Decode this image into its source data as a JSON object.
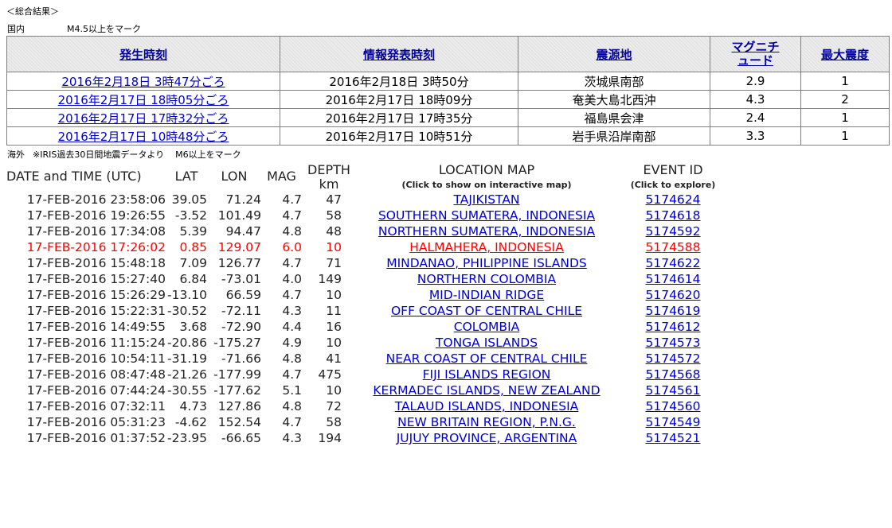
{
  "section_title": "＜総合結果＞",
  "domestic": {
    "label": "国内",
    "note": "M4.5以上をマーク",
    "headers": [
      "発生時刻",
      "情報発表時刻",
      "震源地",
      "マグニチュード",
      "最大震度"
    ],
    "rows": [
      [
        "2016年2月18日 3時47分ごろ",
        "2016年2月18日 3時50分",
        "茨城県南部",
        "2.9",
        "1"
      ],
      [
        "2016年2月17日 18時05分ごろ",
        "2016年2月17日 18時09分",
        "奄美大島北西沖",
        "4.3",
        "2"
      ],
      [
        "2016年2月17日 17時32分ごろ",
        "2016年2月17日 17時35分",
        "福島県会津",
        "2.4",
        "1"
      ],
      [
        "2016年2月17日 10時48分ごろ",
        "2016年2月17日 10時51分",
        "岩手県沿岸南部",
        "3.3",
        "1"
      ]
    ]
  },
  "overseas": {
    "label": "海外",
    "note1": "※IRIS過去30日間地震データより",
    "note2": "M6以上をマーク",
    "headers": {
      "datetime": "DATE and TIME (UTC)",
      "lat": "LAT",
      "lon": "LON",
      "mag": "MAG",
      "depth": "DEPTH",
      "depth_unit": "km",
      "location": "LOCATION MAP",
      "location_sub": "(Click to show on interactive map)",
      "event": "EVENT ID",
      "event_sub": "(Click to explore)"
    },
    "rows": [
      {
        "datetime": "17-FEB-2016 23:58:06",
        "lat": "39.05",
        "lon": "71.24",
        "mag": "4.7",
        "depth": "47",
        "location": "TAJIKISTAN",
        "event": "5174624"
      },
      {
        "datetime": "17-FEB-2016 19:26:55",
        "lat": "-3.52",
        "lon": "101.49",
        "mag": "4.7",
        "depth": "58",
        "location": "SOUTHERN SUMATERA, INDONESIA",
        "event": "5174618"
      },
      {
        "datetime": "17-FEB-2016 17:34:08",
        "lat": "5.39",
        "lon": "94.47",
        "mag": "4.8",
        "depth": "48",
        "location": "NORTHERN SUMATERA, INDONESIA",
        "event": "5174592"
      },
      {
        "datetime": "17-FEB-2016 17:26:02",
        "lat": "0.85",
        "lon": "129.07",
        "mag": "6.0",
        "depth": "10",
        "location": "HALMAHERA, INDONESIA",
        "event": "5174588",
        "highlight": true
      },
      {
        "datetime": "17-FEB-2016 15:48:18",
        "lat": "7.09",
        "lon": "126.77",
        "mag": "4.7",
        "depth": "71",
        "location": "MINDANAO, PHILIPPINE ISLANDS",
        "event": "5174622"
      },
      {
        "datetime": "17-FEB-2016 15:27:40",
        "lat": "6.84",
        "lon": "-73.01",
        "mag": "4.0",
        "depth": "149",
        "location": "NORTHERN COLOMBIA",
        "event": "5174614"
      },
      {
        "datetime": "17-FEB-2016 15:26:29",
        "lat": "-13.10",
        "lon": "66.59",
        "mag": "4.7",
        "depth": "10",
        "location": "MID-INDIAN RIDGE",
        "event": "5174620"
      },
      {
        "datetime": "17-FEB-2016 15:22:31",
        "lat": "-30.52",
        "lon": "-72.11",
        "mag": "4.3",
        "depth": "11",
        "location": "OFF COAST OF CENTRAL CHILE",
        "event": "5174619"
      },
      {
        "datetime": "17-FEB-2016 14:49:55",
        "lat": "3.68",
        "lon": "-72.90",
        "mag": "4.4",
        "depth": "16",
        "location": "COLOMBIA",
        "event": "5174612"
      },
      {
        "datetime": "17-FEB-2016 11:15:24",
        "lat": "-20.86",
        "lon": "-175.27",
        "mag": "4.9",
        "depth": "10",
        "location": "TONGA ISLANDS",
        "event": "5174573"
      },
      {
        "datetime": "17-FEB-2016 10:54:11",
        "lat": "-31.19",
        "lon": "-71.66",
        "mag": "4.8",
        "depth": "41",
        "location": "NEAR COAST OF CENTRAL CHILE",
        "event": "5174572"
      },
      {
        "datetime": "17-FEB-2016 08:47:48",
        "lat": "-21.26",
        "lon": "-177.99",
        "mag": "4.7",
        "depth": "475",
        "location": "FIJI ISLANDS REGION",
        "event": "5174568"
      },
      {
        "datetime": "17-FEB-2016 07:44:24",
        "lat": "-30.55",
        "lon": "-177.62",
        "mag": "5.1",
        "depth": "10",
        "location": "KERMADEC ISLANDS, NEW ZEALAND",
        "event": "5174561"
      },
      {
        "datetime": "17-FEB-2016 07:32:11",
        "lat": "4.73",
        "lon": "127.86",
        "mag": "4.8",
        "depth": "72",
        "location": "TALAUD ISLANDS, INDONESIA",
        "event": "5174560"
      },
      {
        "datetime": "17-FEB-2016 05:31:23",
        "lat": "-4.62",
        "lon": "152.54",
        "mag": "4.7",
        "depth": "58",
        "location": "NEW BRITAIN REGION, P.N.G.",
        "event": "5174549"
      },
      {
        "datetime": "17-FEB-2016 01:37:52",
        "lat": "-23.95",
        "lon": "-66.65",
        "mag": "4.3",
        "depth": "194",
        "location": "JUJUY PROVINCE, ARGENTINA",
        "event": "5174521"
      }
    ]
  }
}
